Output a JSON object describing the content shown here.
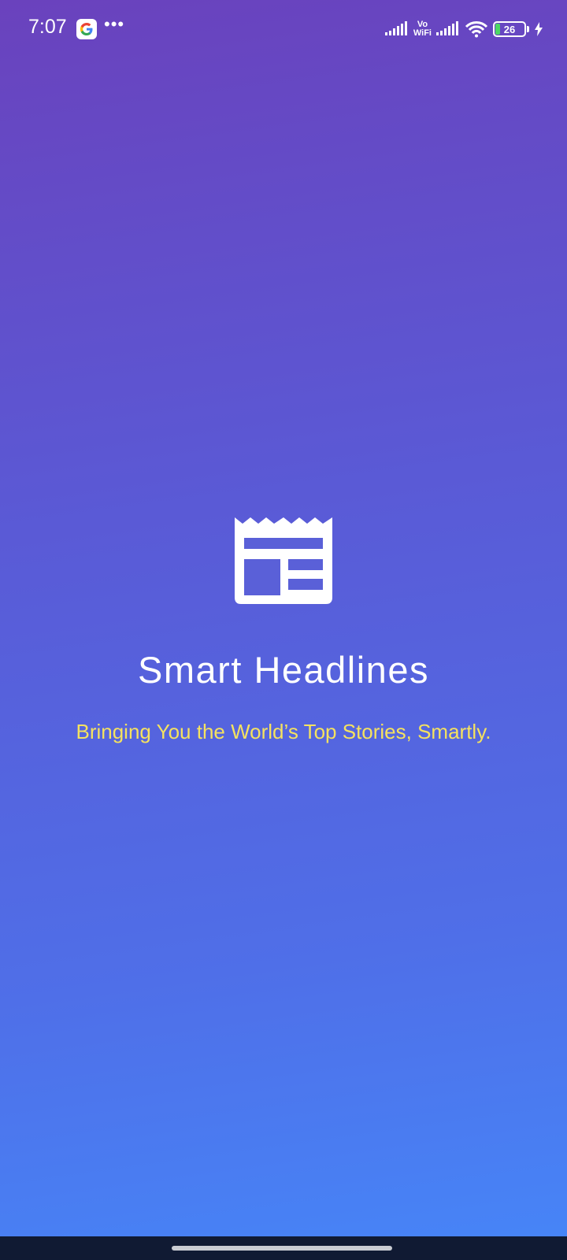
{
  "status_bar": {
    "time": "7:07",
    "vowifi_top": "Vo",
    "vowifi_bottom": "WiFi",
    "battery_level": "26"
  },
  "splash": {
    "title": "Smart Headlines",
    "tagline": "Bringing You the World’s Top Stories, Smartly.",
    "icon": "newspaper-icon"
  },
  "colors": {
    "gradient_top": "#6a42bd",
    "gradient_bottom": "#4686f8",
    "title": "#ffffff",
    "tagline": "#f5e25f"
  }
}
